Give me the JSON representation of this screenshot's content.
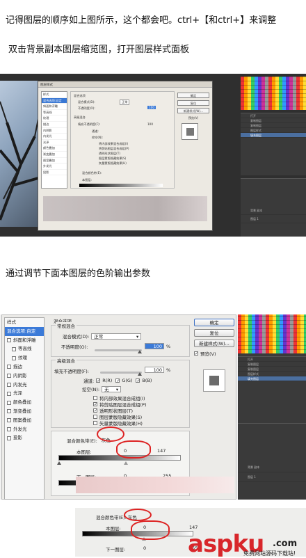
{
  "captions": {
    "c1": "记得图层的顺序如上图所示，这个都会吧。ctrl+【和ctrl+】来调整",
    "c2": "双击背景副本图层缩览图，打开图层样式面板",
    "c3": "通过调节下面本图层的色阶输出参数"
  },
  "dialog": {
    "title": "图层样式",
    "styles_header": "样式",
    "style_items": [
      "混合选项:自定",
      "斜面和浮雕",
      "等高线",
      "纹理",
      "描边",
      "内阴影",
      "内发光",
      "光泽",
      "颜色叠加",
      "渐变叠加",
      "图案叠加",
      "外发光",
      "投影"
    ],
    "blend_title": "混合选项",
    "normal_blend": "常规混合",
    "blend_mode_label": "混合模式(D):",
    "blend_mode_value": "正常",
    "opacity_label": "不透明度(O):",
    "opacity_value": "100",
    "percent": "%",
    "advanced_blend": "高级混合",
    "fill_label": "填充不透明度(F):",
    "fill_value": "100",
    "channels_label": "通道:",
    "ch_r": "R(R)",
    "ch_g": "G(G)",
    "ch_b": "B(B)",
    "knockout_label": "挖空(N):",
    "knockout_value": "无",
    "opt1": "将内部效果混合成组(I)",
    "opt2": "将剪贴图层混合成组(P)",
    "opt3": "透明形状图层(T)",
    "opt4": "图层蒙版隐藏效果(S)",
    "opt5": "矢量蒙版隐藏效果(H)",
    "blend_if_label": "混合颜色带(E):",
    "blend_if_value": "灰色",
    "this_layer": "本图层:",
    "this_low": "0",
    "this_high": "147",
    "under_layer": "下一图层:",
    "under_low": "0",
    "under_high": "255",
    "btn_ok": "确定",
    "btn_reset": "复位",
    "btn_new": "新建样式(W)...",
    "preview_label": "预览(V)"
  },
  "layers": {
    "items": [
      "背景 副本",
      "图层 1"
    ],
    "history": [
      "打开",
      "复制图层",
      "复制图层",
      "图层样式",
      "填充图层"
    ]
  },
  "watermark": {
    "brand": "aspku",
    "domain": ".com",
    "tagline": "免费网站源码下载站!"
  },
  "colors": {
    "accent": "#3b7ad8",
    "annotation": "#d22222",
    "brand": "#d8262a"
  }
}
